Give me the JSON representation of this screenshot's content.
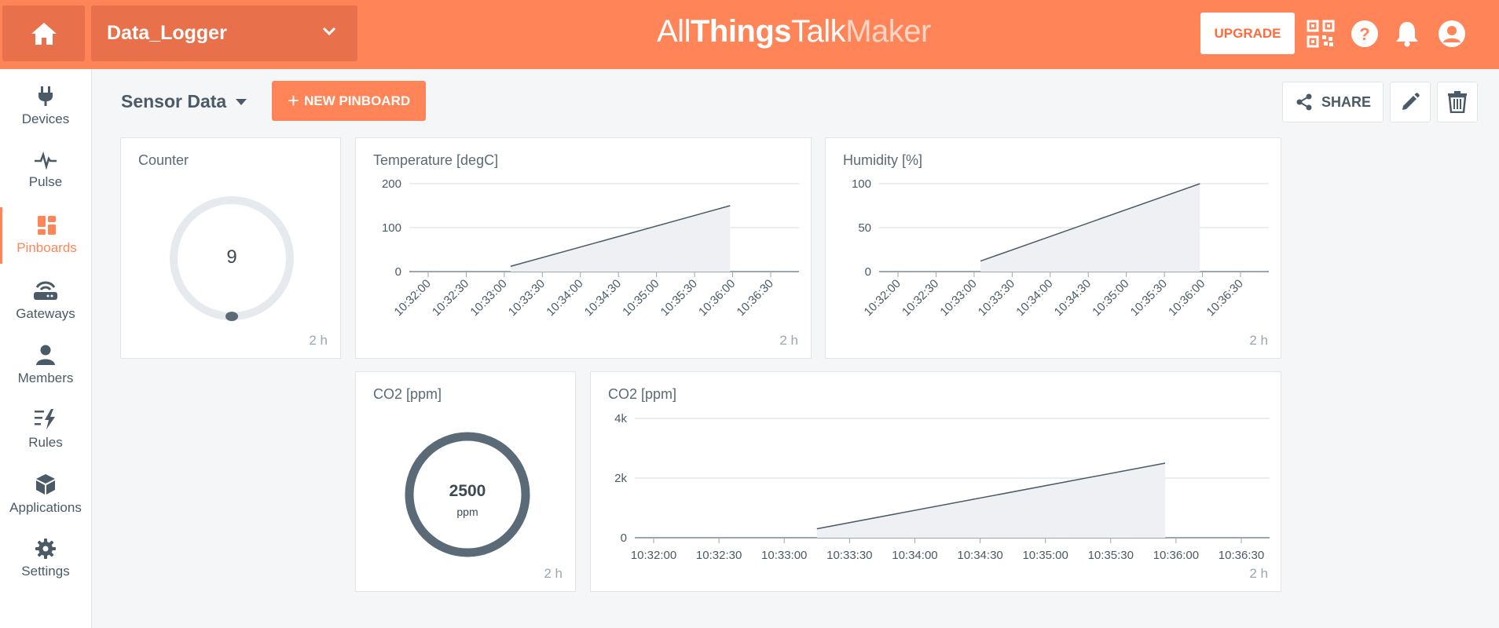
{
  "header": {
    "device_name": "Data_Logger",
    "brand": {
      "part1": "All",
      "part2": "Things",
      "part3": "Talk",
      "part4": "Maker"
    },
    "upgrade_label": "UPGRADE"
  },
  "sidebar": {
    "items": [
      {
        "label": "Devices",
        "icon": "plug-icon"
      },
      {
        "label": "Pulse",
        "icon": "pulse-icon"
      },
      {
        "label": "Pinboards",
        "icon": "pinboards-icon",
        "active": true
      },
      {
        "label": "Gateways",
        "icon": "gateway-icon"
      },
      {
        "label": "Members",
        "icon": "person-icon"
      },
      {
        "label": "Rules",
        "icon": "rules-icon"
      },
      {
        "label": "Applications",
        "icon": "cube-icon"
      },
      {
        "label": "Settings",
        "icon": "gear-icon"
      }
    ]
  },
  "toolbar": {
    "pinboard_name": "Sensor Data",
    "new_pinboard_label": "NEW PINBOARD",
    "share_label": "SHARE"
  },
  "colors": {
    "accent": "#ff8559",
    "accent_dark": "#e8704a",
    "gauge_track": "#e6e9ee",
    "gauge_dark": "#5a6a76"
  },
  "cards": {
    "counter": {
      "title": "Counter",
      "value": "9",
      "footer": "2 h"
    },
    "temperature": {
      "title": "Temperature [degC]",
      "footer": "2 h"
    },
    "humidity": {
      "title": "Humidity [%]",
      "footer": "2 h"
    },
    "co2_gauge": {
      "title": "CO2 [ppm]",
      "value": "2500",
      "unit": "ppm",
      "footer": "2 h"
    },
    "co2_chart": {
      "title": "CO2 [ppm]",
      "footer": "2 h"
    }
  },
  "chart_data": [
    {
      "type": "area",
      "x": [
        "10:33:05",
        "10:35:58"
      ],
      "y": [
        12,
        150
      ],
      "xticks": [
        "10:32:00",
        "10:32:30",
        "10:33:00",
        "10:33:30",
        "10:34:00",
        "10:34:30",
        "10:35:00",
        "10:35:30",
        "10:36:00",
        "10:36:30"
      ],
      "yticks": [
        "0",
        "100",
        "200"
      ],
      "ylim": [
        0,
        200
      ]
    },
    {
      "type": "area",
      "x": [
        "10:33:05",
        "10:35:58"
      ],
      "y": [
        12,
        100
      ],
      "xticks": [
        "10:32:00",
        "10:32:30",
        "10:33:00",
        "10:33:30",
        "10:34:00",
        "10:34:30",
        "10:35:00",
        "10:35:30",
        "10:36:00",
        "10:36:30"
      ],
      "yticks": [
        "0",
        "50",
        "100"
      ],
      "ylim": [
        0,
        100
      ]
    },
    {
      "type": "area",
      "x": [
        "10:33:15",
        "10:35:55"
      ],
      "y": [
        300,
        2500
      ],
      "xticks": [
        "10:32:00",
        "10:32:30",
        "10:33:00",
        "10:33:30",
        "10:34:00",
        "10:34:30",
        "10:35:00",
        "10:35:30",
        "10:36:00",
        "10:36:30"
      ],
      "yticks": [
        "0",
        "2k",
        "4k"
      ],
      "ylim": [
        0,
        4000
      ]
    }
  ]
}
